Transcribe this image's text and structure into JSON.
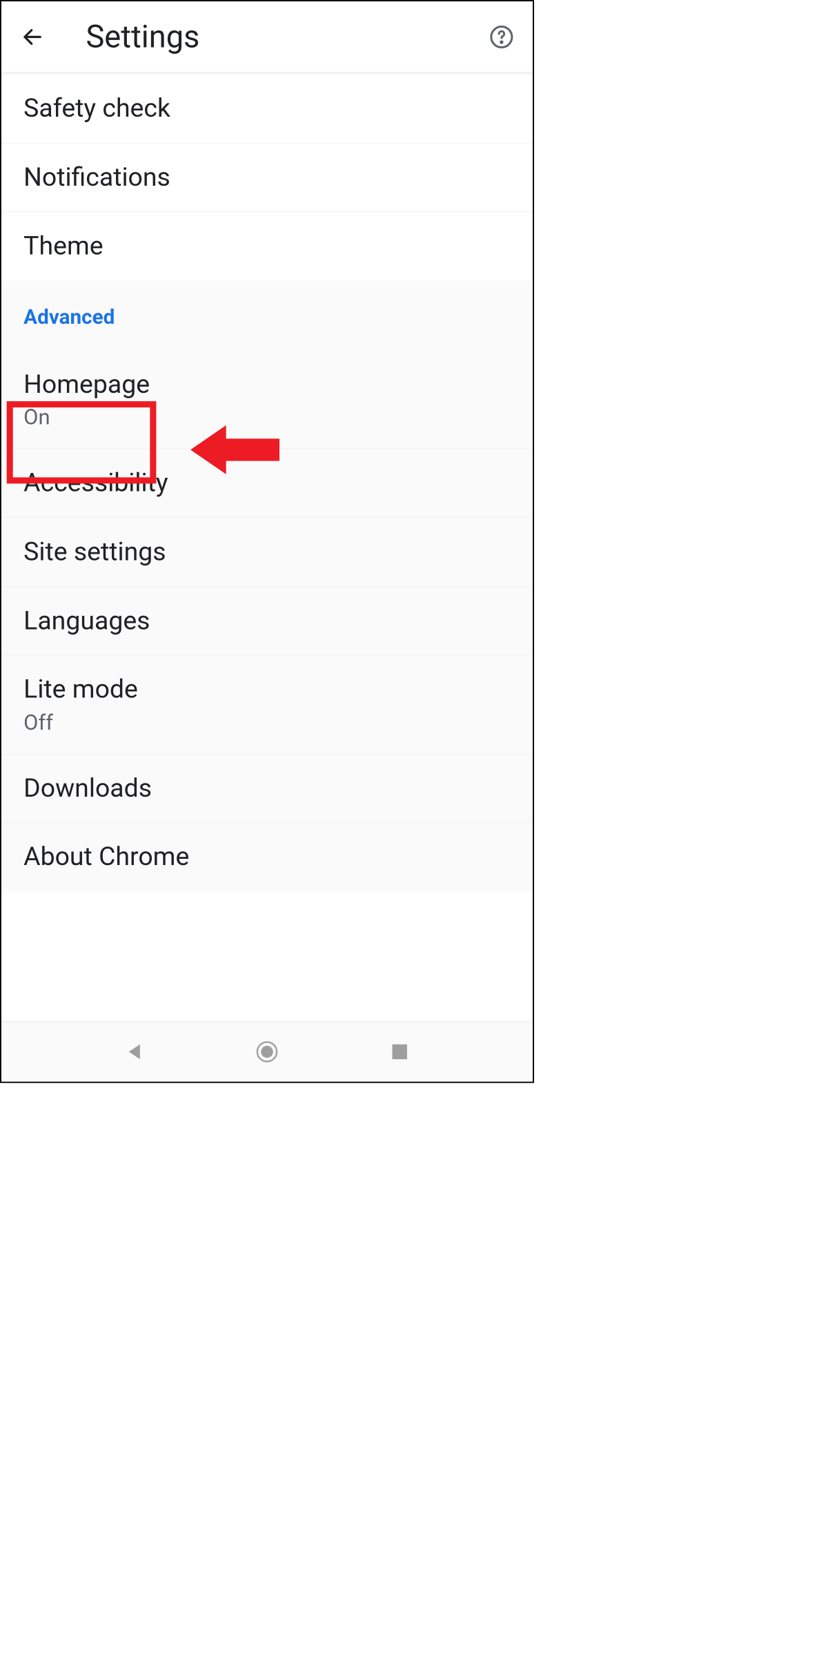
{
  "header": {
    "title": "Settings"
  },
  "items_basic": [
    {
      "label": "Safety check"
    },
    {
      "label": "Notifications"
    },
    {
      "label": "Theme"
    }
  ],
  "section_label": "Advanced",
  "items_advanced": [
    {
      "label": "Homepage",
      "sub": "On"
    },
    {
      "label": "Accessibility"
    },
    {
      "label": "Site settings"
    },
    {
      "label": "Languages"
    },
    {
      "label": "Lite mode",
      "sub": "Off"
    },
    {
      "label": "Downloads"
    },
    {
      "label": "About Chrome"
    }
  ],
  "annotation": {
    "highlight_color": "#ed1c24"
  }
}
